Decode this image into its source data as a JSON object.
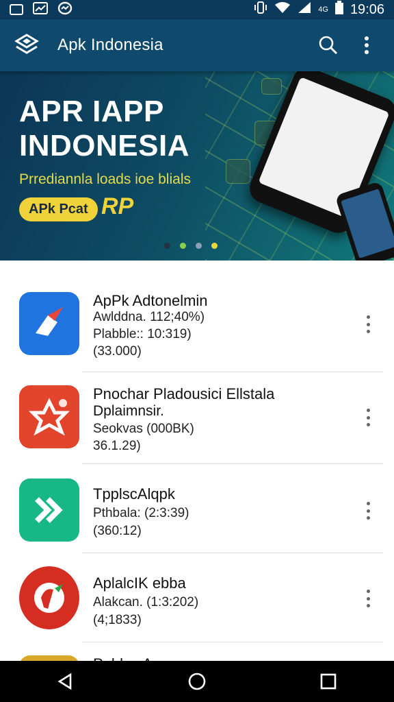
{
  "status_bar": {
    "time": "19:06",
    "signal_label": "4G",
    "icons": [
      "image-icon",
      "chart-icon",
      "messenger-icon",
      "vibrate-icon",
      "wifi-icon",
      "signal-icon",
      "battery-icon"
    ]
  },
  "appbar": {
    "title": "Apk Indonesia",
    "icons": [
      "app-logo-icon",
      "search-icon",
      "more-vert-icon"
    ]
  },
  "banner": {
    "title_line1": "APR IAPP",
    "title_line2": "INDONESIA",
    "subtitle": "Prrediannla loads ioe blials",
    "pill_label": "APk Pcat",
    "badge_text": "RP",
    "page_indicator": {
      "count": 4,
      "active_index": 1
    },
    "colors": {
      "title": "#ffffff",
      "subtitle": "#e5dc4d",
      "pill": "#f0d33a"
    }
  },
  "apps": [
    {
      "name": "ApPk Adtonelmin",
      "lines": [
        "Awlddna.     112;40%)",
        "Plabble:: 10:319)",
        "(33.000)"
      ],
      "icon": "blue-arrow-app-icon",
      "color": "#1f74e0"
    },
    {
      "name": "Pnochar Pladousici Ellstala",
      "lines": [
        "Dplaimnsir.",
        "Seokvas (000BK)",
        "36.1.29)"
      ],
      "icon": "red-star-app-icon",
      "color": "#e2452b"
    },
    {
      "name": "TpplscAlqpk",
      "lines": [
        "Pthbala: (2:3:39)",
        "(360:12)"
      ],
      "icon": "green-arrow-app-icon",
      "color": "#17b886"
    },
    {
      "name": "AplalcIK ebba",
      "lines": [
        "Alakcan. (1:3:202)",
        "(4;1833)"
      ],
      "icon": "red-circle-app-icon",
      "color": "#d62d22"
    },
    {
      "name": "Pnblas Apnu",
      "lines": [],
      "icon": "yellow-app-icon",
      "color": "#d9a72a"
    }
  ],
  "navbar": {
    "icons": [
      "back-icon",
      "home-icon",
      "recents-icon"
    ]
  }
}
